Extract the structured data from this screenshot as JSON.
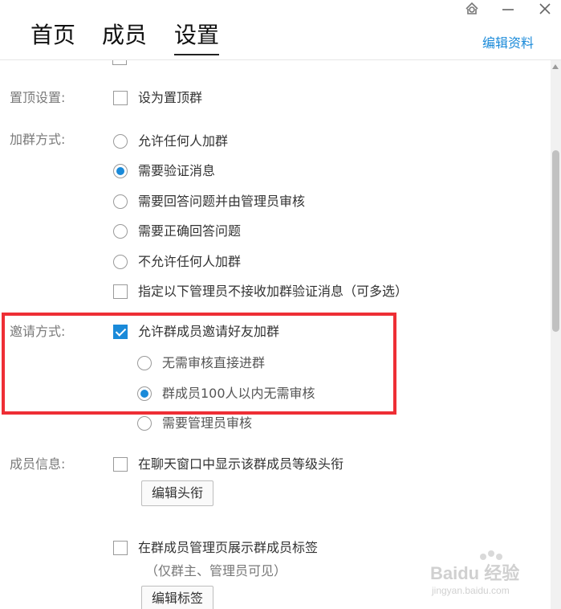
{
  "tabs": [
    {
      "label": "首页",
      "active": false
    },
    {
      "label": "成员",
      "active": false
    },
    {
      "label": "设置",
      "active": true
    }
  ],
  "header": {
    "edit_profile": "编辑资料"
  },
  "window_controls": [
    "skin-icon",
    "minimize-icon",
    "close-icon"
  ],
  "settings": {
    "cut_label": "",
    "cut_option": "",
    "pin": {
      "label": "置顶设置:",
      "option": "设为置顶群",
      "checked": false
    },
    "join": {
      "label": "加群方式:",
      "options": [
        {
          "text": "允许任何人加群",
          "checked": false
        },
        {
          "text": "需要验证消息",
          "checked": true
        },
        {
          "text": "需要回答问题并由管理员审核",
          "checked": false
        },
        {
          "text": "需要正确回答问题",
          "checked": false
        },
        {
          "text": "不允许任何人加群",
          "checked": false
        }
      ],
      "admin_exclude": {
        "text": "指定以下管理员不接收加群验证消息（可多选）",
        "checked": false
      }
    },
    "invite": {
      "label": "邀请方式:",
      "main": {
        "text": "允许群成员邀请好友加群",
        "checked": true
      },
      "sub": [
        {
          "text": "无需审核直接进群",
          "checked": false
        },
        {
          "text": "群成员100人以内无需审核",
          "checked": true
        },
        {
          "text": "需要管理员审核",
          "checked": false
        }
      ]
    },
    "member_info": {
      "label": "成员信息:",
      "show_rank": {
        "text": "在聊天窗口中显示该群成员等级头衔",
        "checked": false
      },
      "edit_rank_button": "编辑头衔",
      "show_tags": {
        "text": "在群成员管理页展示群成员标签",
        "checked": false
      },
      "tags_note": "（仅群主、管理员可见）",
      "edit_tags_button": "编辑标签"
    }
  },
  "watermark": {
    "brand": "Baidu 经验",
    "url": "jingyan.baidu.com"
  },
  "colors": {
    "accent": "#1a8ad9",
    "highlight": "#ee2e35"
  }
}
